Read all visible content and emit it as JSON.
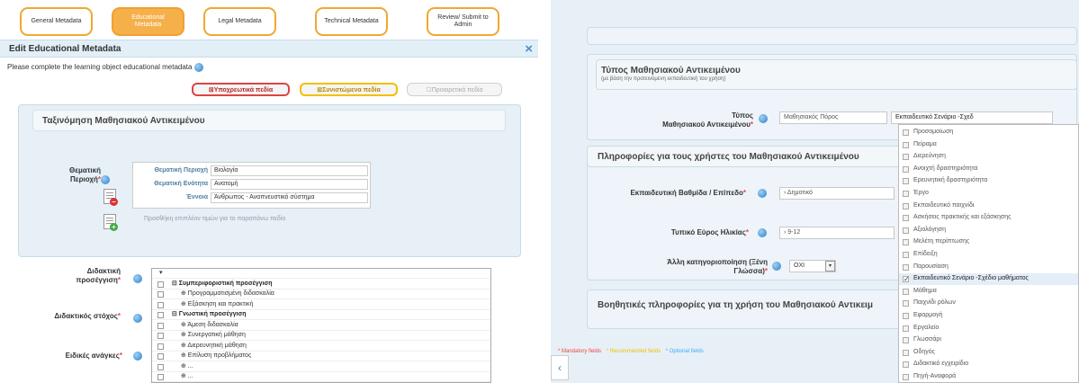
{
  "wizard": {
    "steps": [
      {
        "label": "General Metadata"
      },
      {
        "label": "Educational Metadata"
      },
      {
        "label": "Legal Metadata"
      },
      {
        "label": "Technical Metadata"
      },
      {
        "label": "Review/ Submit to Admin"
      }
    ],
    "active_step": 1
  },
  "left": {
    "title": "Edit Educational Metadata",
    "close_icon": "×",
    "intro": "Please complete the learning object educational metadata",
    "pills": {
      "required": "⊠Υποχρεωτικά πεδία",
      "recommended": "⊠Συνιστώμενα πεδία",
      "optional": "☐Προαιρετικά πεδία"
    },
    "section_title": "Ταξινόμηση Μαθησιακού Αντικειμένου",
    "thematic_label": "Θεματική Περιοχή",
    "thematic_rows": [
      {
        "label": "Θεματική Περιοχή",
        "value": "Βιολογία"
      },
      {
        "label": "Θεματική Ενότητα",
        "value": "Ανατομή"
      },
      {
        "label": "Έννοια",
        "value": "Άνθρωπος - Αναπνευστικό σύστημα"
      }
    ],
    "add_note": "Προσθήκη επιπλέον τιμών για το παραπάνω πεδίο",
    "didactic_approach_label": "Διδακτική προσέγγιση",
    "didactic_goal_label": "Διδακτικός στόχος",
    "special_needs_label": "Ειδικές ανάγκες",
    "tree_items": [
      {
        "text": "▾",
        "bold": false,
        "indent": 8,
        "checkbox": false
      },
      {
        "text": "⊟ Συμπεριφοριστική προσέγγιση",
        "bold": true,
        "indent": 22,
        "checkbox": true
      },
      {
        "text": "⊕ Προγραμματισμένη διδασκαλία",
        "bold": false,
        "indent": 32,
        "checkbox": true
      },
      {
        "text": "⊕ Εξάσκηση και πρακτική",
        "bold": false,
        "indent": 32,
        "checkbox": true
      },
      {
        "text": "⊟ Γνωστική προσέγγιση",
        "bold": true,
        "indent": 22,
        "checkbox": true
      },
      {
        "text": "⊕ Άμεση διδασκαλία",
        "bold": false,
        "indent": 32,
        "checkbox": true
      },
      {
        "text": "⊕ Συνεργατική μάθηση",
        "bold": false,
        "indent": 32,
        "checkbox": true
      },
      {
        "text": "⊕ Διερευνητική μάθηση",
        "bold": false,
        "indent": 32,
        "checkbox": true
      },
      {
        "text": "⊕ Επίλυση προβλήματος",
        "bold": false,
        "indent": 32,
        "checkbox": true
      },
      {
        "text": "⊕ ...",
        "bold": false,
        "indent": 32,
        "checkbox": true
      },
      {
        "text": "⊕ ...",
        "bold": false,
        "indent": 32,
        "checkbox": true
      }
    ]
  },
  "right": {
    "type_title": "Τύπος Μαθησιακού Αντικειμένου",
    "type_subtitle": "(με βάση την προτεινόμενη εκπαιδευτική του χρήση)",
    "type_label_1": "Τύπος",
    "type_label_2": "Μαθησιακού Αντικειμένου",
    "type_input": "Μαθησιακός Πόρος",
    "type_select": "Εκπαιδευτικό Σενάριο -Σχεδ",
    "users_title": "Πληροφορίες για τους χρήστες του Μαθησιακού Αντικειμένου",
    "level_label": "Εκπαιδευτική Βαθμίδα / Επίπεδο",
    "level_value": "› Δημοτικό",
    "age_label": "Τυπικό Εύρος Ηλικίας",
    "age_value": "› 9-12",
    "lang_label_1": "Άλλη κατηγοριοποίηση (Ξένη",
    "lang_label_2": "Γλώσσα)",
    "lang_value": "ΟΧΙ",
    "aux_title": "Βοηθητικές πληροφορίες για τη χρήση του Μαθησιακού Αντικειμ",
    "legend": {
      "mandatory": "* Mandatory fields",
      "recommended": "* Recommended fields",
      "optional": "* Optional fields"
    },
    "back_arrow": "‹"
  },
  "dropdown": {
    "items": [
      {
        "label": "Προσομοίωση",
        "checked": false
      },
      {
        "label": "Πείραμα",
        "checked": false
      },
      {
        "label": "Διερεύνηση",
        "checked": false
      },
      {
        "label": "Ανοιχτή δραστηριότητα",
        "checked": false
      },
      {
        "label": "Ερευνητική δραστηριότητα",
        "checked": false
      },
      {
        "label": "Έργο",
        "checked": false
      },
      {
        "label": "Εκπαιδευτικό παιχνίδι",
        "checked": false
      },
      {
        "label": "Ασκήσεις πρακτικής και εξάσκησης",
        "checked": false
      },
      {
        "label": "Αξιολόγηση",
        "checked": false
      },
      {
        "label": "Μελέτη περίπτωσης",
        "checked": false
      },
      {
        "label": "Επίδειξη",
        "checked": false
      },
      {
        "label": "Παρουσίαση",
        "checked": false
      },
      {
        "label": "Εκπαιδευτικό Σενάριο -Σχέδιο μαθήματος",
        "checked": true
      },
      {
        "label": "Μάθημα",
        "checked": false
      },
      {
        "label": "Παιχνίδι ρόλων",
        "checked": false
      },
      {
        "label": "Εφαρμογή",
        "checked": false
      },
      {
        "label": "Εργαλείο",
        "checked": false
      },
      {
        "label": "Γλωσσάρι",
        "checked": false
      },
      {
        "label": "Οδηγός",
        "checked": false
      },
      {
        "label": "Διδακτικό εγχειρίδιο",
        "checked": false
      },
      {
        "label": "Πηγή-Αναφορά",
        "checked": false
      }
    ]
  },
  "colors": {
    "accent_orange": "#f0a830",
    "header_blue": "#4a90c8",
    "panel_bg": "#e6f0f6",
    "required": "#e44",
    "recommended": "#f0c000",
    "optional": "#3fa9f5"
  }
}
